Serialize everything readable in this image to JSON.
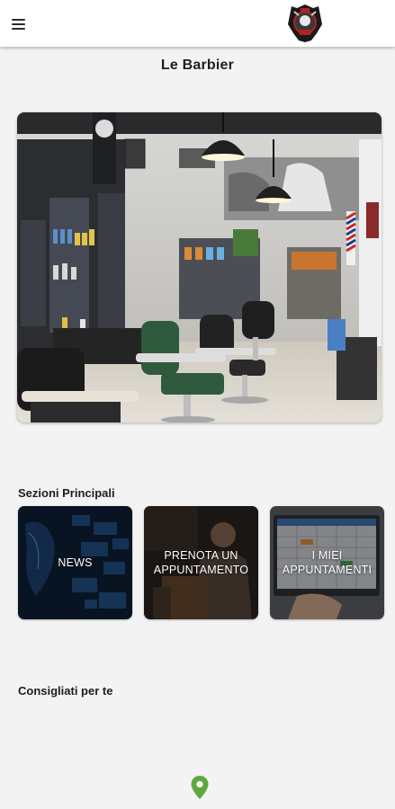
{
  "app": {
    "title": "Le Barbier"
  },
  "main_sections": {
    "heading": "Sezioni Principali",
    "cards": [
      {
        "label": "NEWS"
      },
      {
        "label": "PRENOTA UN APPUNTAMENTO"
      },
      {
        "label": "I MIEI APPUNTAMENTI"
      }
    ]
  },
  "recommended": {
    "heading": "Consigliati per te"
  },
  "colors": {
    "accent_green": "#5fa83f",
    "appbar": "#ffffff",
    "background": "#f3f3f3"
  },
  "icons": {
    "menu": "hamburger-icon",
    "map": "map-pin-icon",
    "logo": "barber-logo"
  }
}
